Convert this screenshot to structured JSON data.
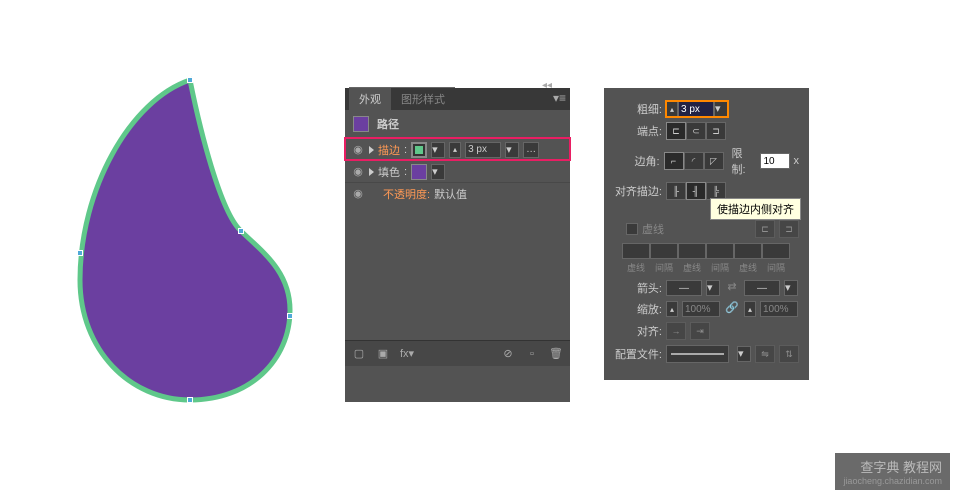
{
  "appearance": {
    "tab_active": "外观",
    "tab_inactive": "图形样式",
    "path_label": "路径",
    "stroke_row": {
      "label": "描边",
      "value": "3 px"
    },
    "fill_row": {
      "label": "填色"
    },
    "opacity_row": {
      "label": "不透明度:",
      "value": "默认值"
    }
  },
  "stroke": {
    "weight_label": "粗细:",
    "weight_value": "3 px",
    "cap_label": "端点:",
    "corner_label": "边角:",
    "limit_label": "限制:",
    "limit_value": "10",
    "limit_unit": "x",
    "align_label": "对齐描边:",
    "tooltip": "使描边内侧对齐",
    "dashed_label": "虚线",
    "dash_labels": [
      "虚线",
      "间隔",
      "虚线",
      "间隔",
      "虚线",
      "间隔"
    ],
    "arrow_label": "箭头:",
    "arrow_none": "—",
    "scale_label": "缩放:",
    "scale_value": "100%",
    "align_arrow_label": "对齐:",
    "profile_label": "配置文件:"
  },
  "colors": {
    "fill": "#6b3fa0",
    "stroke": "#5fc88a"
  },
  "watermark": {
    "line1": "查字典 教程网",
    "line2": "jiaocheng.chazidian.com"
  }
}
